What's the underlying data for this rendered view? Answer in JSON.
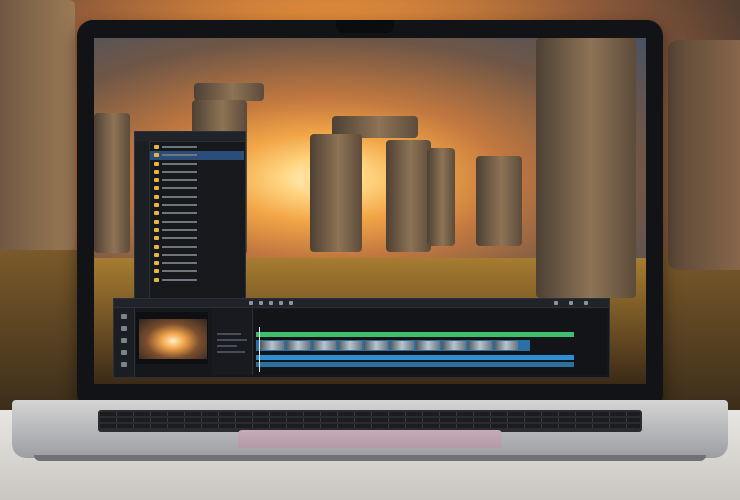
{
  "scene": {
    "description_colors": {
      "sunset": "#ffc36a",
      "screen_bg": "#15171b",
      "accent_blue": "#2c8fd6",
      "accent_green": "#3fbf6d",
      "folder": "#e3b447"
    }
  },
  "file_panel": {
    "items": [
      "",
      "",
      "",
      "",
      "",
      "",
      "",
      "",
      "",
      "",
      "",
      "",
      "",
      "",
      "",
      "",
      ""
    ]
  },
  "icons": [
    "folder-icon",
    "play-icon",
    "timeline-icon",
    "video-clip-icon"
  ]
}
